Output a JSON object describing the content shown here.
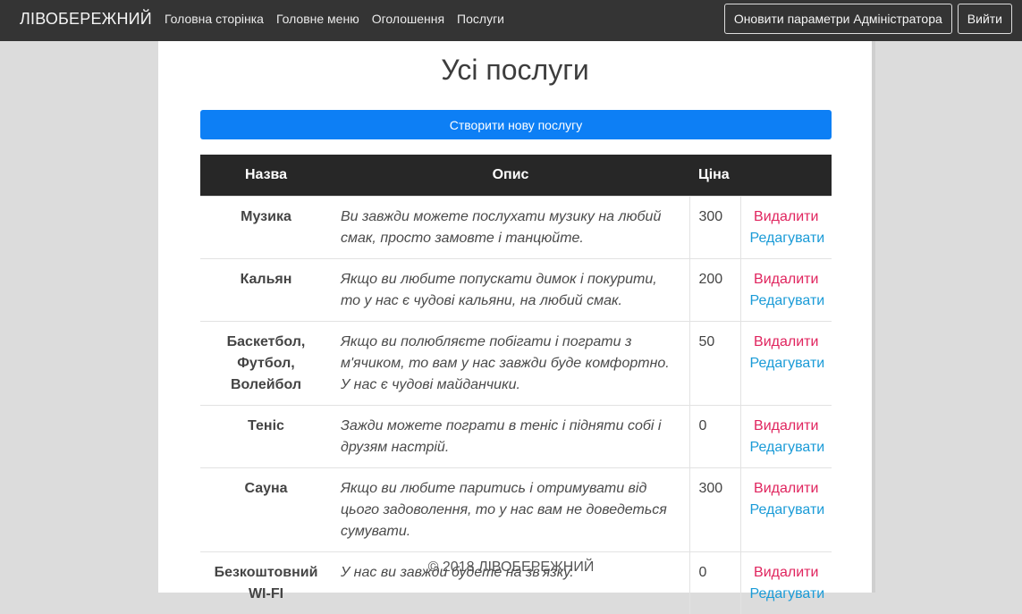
{
  "navbar": {
    "brand": "ЛІВОБЕРЕЖНИЙ",
    "links": [
      "Головна сторінка",
      "Головне меню",
      "Оголошення",
      "Послуги"
    ],
    "update_admin_label": "Оновити параметри Адміністратора",
    "logout_label": "Вийти"
  },
  "main": {
    "title": "Усі послуги",
    "create_button_label": "Створити нову послугу",
    "table": {
      "headers": [
        "Назва",
        "Опис",
        "Ціна"
      ],
      "delete_label": "Видалити",
      "edit_label": "Редагувати",
      "rows": [
        {
          "name": "Музика",
          "description": "Ви завжди можете послухати музику на любий смак, просто замовте і танцюйте.",
          "price": "300"
        },
        {
          "name": "Кальян",
          "description": "Якщо ви любите попускати димок і покурити, то у нас є чудові кальяни, на любий смак.",
          "price": "200"
        },
        {
          "name": "Баскетбол, Футбол, Волейбол",
          "description": "Якщо ви полюбляєте побігати і пограти з м'ячиком, то вам у нас завжди буде комфортно. У нас є чудові майданчики.",
          "price": "50"
        },
        {
          "name": "Теніс",
          "description": "Зажди можете пограти в теніс і підняти собі і друзям настрій.",
          "price": "0"
        },
        {
          "name": "Сауна",
          "description": "Якщо ви любите паритись і отримувати від цього задоволення, то у нас вам не доведеться сумувати.",
          "price": "300"
        },
        {
          "name": "Безкоштовний WI-FI",
          "description": "У нас ви завжди будете на зв'язку.",
          "price": "0"
        }
      ]
    }
  },
  "footer": {
    "text": "© 2018 ЛІВОБЕРЕЖНИЙ"
  }
}
